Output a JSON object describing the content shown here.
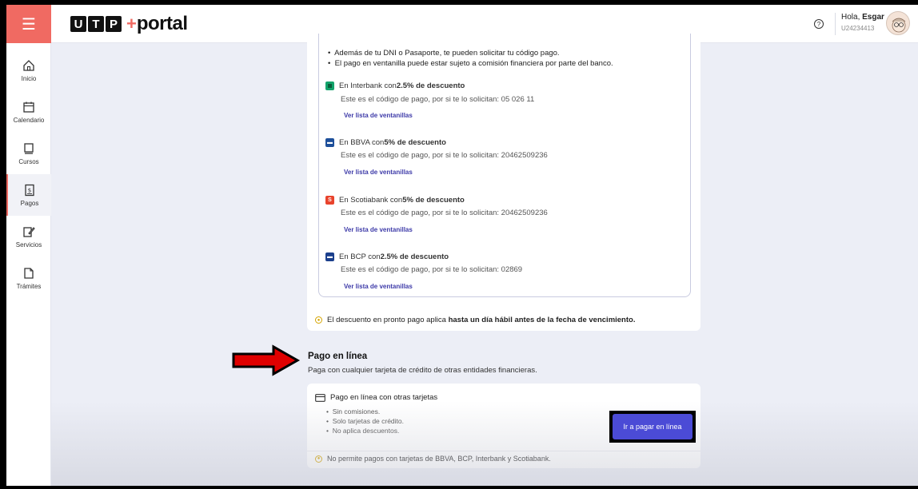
{
  "header": {
    "brand_box": "UTP",
    "brand_plus": "+",
    "brand_text": "portal",
    "greeting_prefix": "Hola, ",
    "greeting_name": "Esgar",
    "user_code": "U24234413"
  },
  "sidebar": {
    "items": [
      {
        "label": "Inicio",
        "icon": "home-icon"
      },
      {
        "label": "Calendario",
        "icon": "calendar-icon"
      },
      {
        "label": "Cursos",
        "icon": "book-icon"
      },
      {
        "label": "Pagos",
        "icon": "payment-icon"
      },
      {
        "label": "Servicios",
        "icon": "edit-icon"
      },
      {
        "label": "Trámites",
        "icon": "document-icon"
      }
    ],
    "active": "Pagos"
  },
  "info": {
    "bullets": [
      "Además de tu DNI o Pasaporte, te pueden solicitar tu código pago.",
      "El pago en ventanilla puede estar sujeto a comisión financiera por parte del banco."
    ]
  },
  "banks": [
    {
      "prefix": "En Interbank con ",
      "discount": "2.5% de descuento",
      "code_text": "Este es el código de pago, por si te lo solicitan: 05 026 11",
      "link": "Ver lista de ventanillas",
      "color": "#13a36b",
      "glyph": "■"
    },
    {
      "prefix": "En BBVA con ",
      "discount": "5% de descuento",
      "code_text": "Este es el código de pago, por si te lo solicitan: 20462509236",
      "link": "Ver lista de ventanillas",
      "color": "#1d4f9a",
      "glyph": "▬"
    },
    {
      "prefix": "En Scotiabank con ",
      "discount": "5% de descuento",
      "code_text": "Este es el código de pago, por si te lo solicitan: 20462509236",
      "link": "Ver lista de ventanillas",
      "color": "#e8432c",
      "glyph": "S"
    },
    {
      "prefix": "En BCP con ",
      "discount": "2.5% de descuento",
      "code_text": "Este es el código de pago, por si te lo solicitan: 02869",
      "link": "Ver lista de ventanillas",
      "color": "#1b3f8c",
      "glyph": "▬"
    }
  ],
  "discount_notice": {
    "prefix": "El descuento en pronto pago aplica ",
    "bold": "hasta un día hábil antes de la fecha de vencimiento."
  },
  "online": {
    "title": "Pago en línea",
    "subtitle": "Paga con cualquier tarjeta de crédito de otras entidades financieras.",
    "card_title": "Pago en línea con otras tarjetas",
    "features": [
      "Sin comisiones.",
      "Solo tarjetas de crédito.",
      "No aplica descuentos."
    ],
    "button_label": "Ir a pagar en línea",
    "footer_note": "No permite pagos con tarjetas de BBVA, BCP, Interbank y Scotiabank."
  },
  "colors": {
    "accent": "#f06a62",
    "primary_button": "#4b4bd6",
    "link": "#3d3aa8",
    "annotation_arrow": "#e00000"
  }
}
